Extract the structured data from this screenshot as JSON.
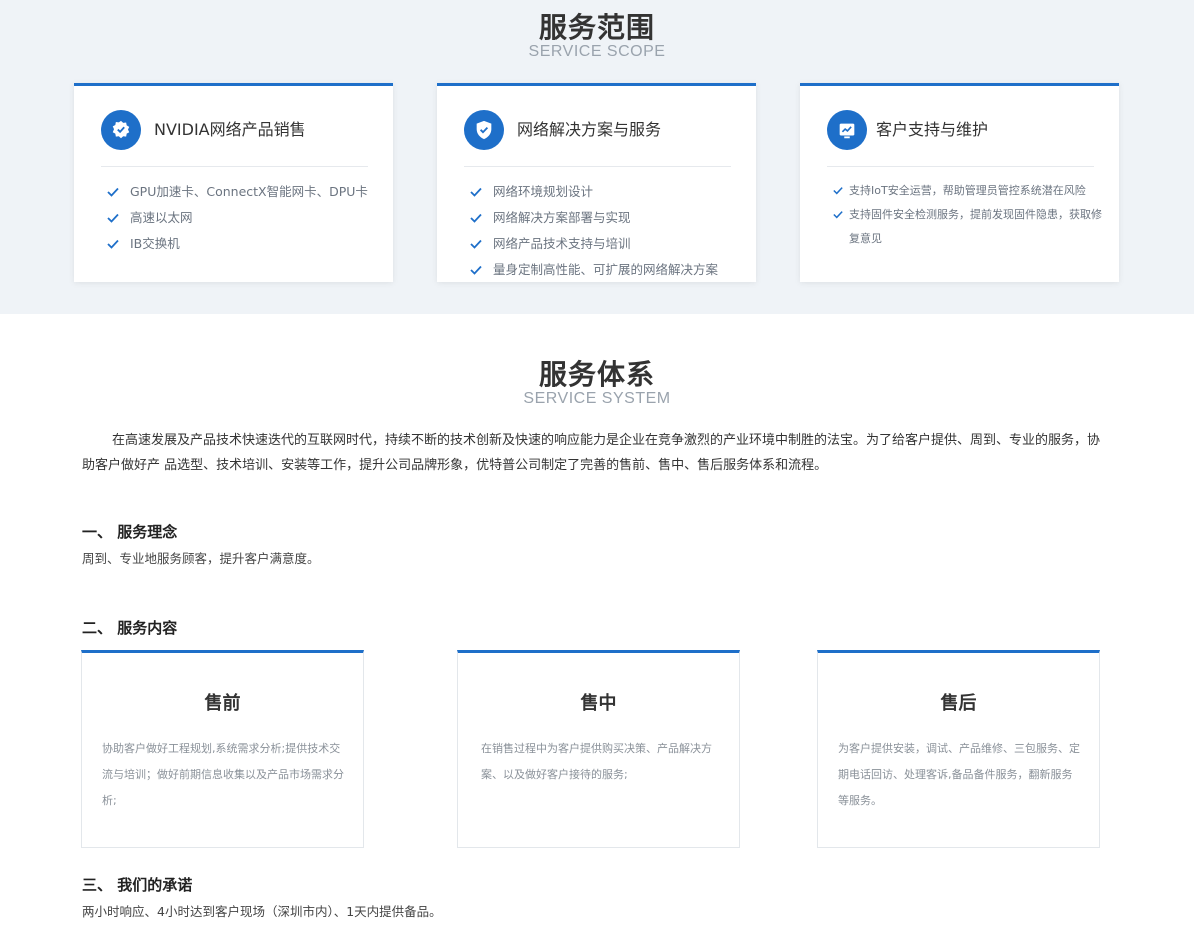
{
  "scope": {
    "title": "服务范围",
    "subtitle": "SERVICE SCOPE",
    "cards": [
      {
        "icon": "badge-check-icon",
        "name": "NVIDIA网络产品销售",
        "items": [
          "GPU加速卡、ConnectX智能网卡、DPU卡",
          "高速以太网",
          "IB交换机"
        ]
      },
      {
        "icon": "shield-check-icon",
        "name": "网络解决方案与服务",
        "items": [
          "网络环境规划设计",
          "网络解决方案部署与实现",
          "网络产品技术支持与培训",
          "量身定制高性能、可扩展的网络解决方案"
        ]
      },
      {
        "icon": "trend-chart-icon",
        "name": "客户支持与维护",
        "items": [
          "支持IoT安全运营，帮助管理员管控系统潜在风险",
          "支持固件安全检测服务，提前发现固件隐患，获取修复意见"
        ]
      }
    ]
  },
  "system": {
    "title": "服务体系",
    "subtitle": "SERVICE SYSTEM",
    "intro": "在高速发展及产品技术快速迭代的互联网时代，持续不断的技术创新及快速的响应能力是企业在竞争激烈的产业环境中制胜的法宝。为了给客户提供、周到、专业的服务，协助客户做好产 品选型、技术培训、安装等工作，提升公司品牌形象，优特普公司制定了完善的售前、售中、售后服务体系和流程。",
    "philosophy_heading": "一、 服务理念",
    "philosophy_text": "周到、专业地服务顾客，提升客户满意度。",
    "content_heading": "二、 服务内容",
    "stages": [
      {
        "title": "售前",
        "text": "协助客户做好工程规划,系统需求分析;提供技术交流与培训；做好前期信息收集以及产品市场需求分析;"
      },
      {
        "title": "售中",
        "text": "在销售过程中为客户提供购买决策、产品解决方案、以及做好客户接待的服务;"
      },
      {
        "title": "售后",
        "text": "为客户提供安装，调试、产品维修、三包服务、定期电话回访、处理客诉,备品备件服务，翻新服务等服务。"
      }
    ],
    "promise_heading": "三、 我们的承诺",
    "promise_text": "两小时响应、4小时达到客户现场（深圳市内）、1天内提供备品。"
  },
  "colors": {
    "accent": "#1e6fc9",
    "band": "#eff3f7"
  }
}
